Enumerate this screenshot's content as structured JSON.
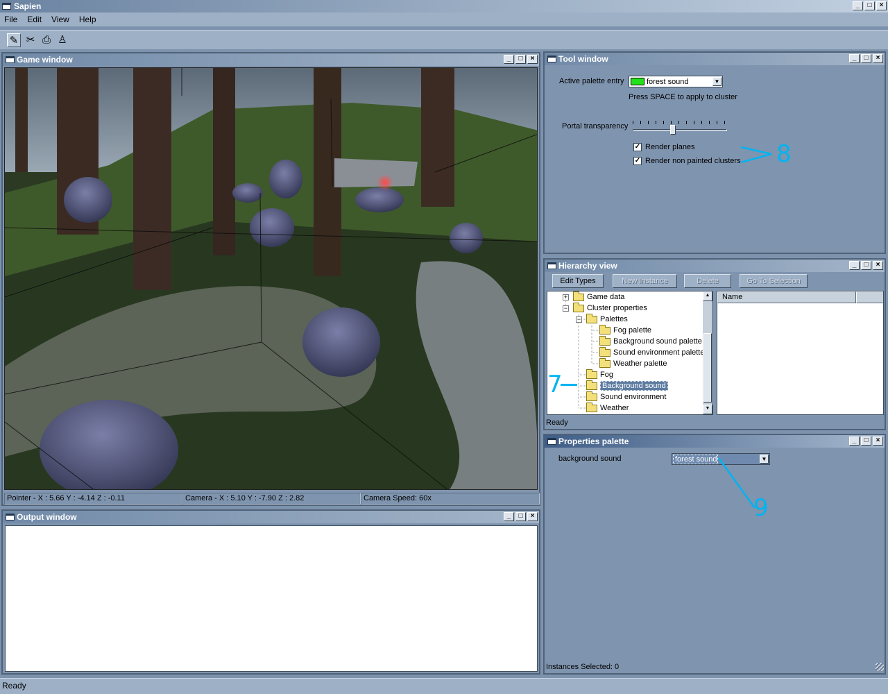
{
  "app": {
    "title": "Sapien",
    "window_buttons": [
      "_",
      "□",
      "×"
    ]
  },
  "menu": {
    "items": [
      "File",
      "Edit",
      "View",
      "Help"
    ]
  },
  "toolbar": {
    "tools": [
      "pencil-tool-icon",
      "pointer-tool-icon",
      "camera-tool-icon",
      "character-tool-icon"
    ]
  },
  "game_window": {
    "title": "Game window",
    "status": {
      "pointer": "Pointer - X : 5.66  Y : -4.14  Z : -0.11",
      "camera": "Camera - X : 5.10  Y : -7.90  Z : 2.82",
      "speed": "Camera Speed: 60x"
    }
  },
  "output_window": {
    "title": "Output window"
  },
  "tool_window": {
    "title": "Tool window",
    "active_palette_label": "Active palette entry",
    "active_palette_value": "forest sound",
    "swatch_color": "#23e01a",
    "hint": "Press SPACE to apply to cluster",
    "portal_label": "Portal transparency",
    "portal_level": 0.42,
    "render_planes": "Render planes",
    "render_non_painted": "Render non painted clusters",
    "render_planes_checked": true,
    "render_non_painted_checked": true
  },
  "hierarchy": {
    "title": "Hierarchy view",
    "buttons": [
      "Edit Types",
      "New Instance",
      "Delete",
      "Go To Selection"
    ],
    "tree": [
      "Game data",
      "Cluster properties",
      "Palettes",
      "Fog palette",
      "Background sound palette",
      "Sound environment palette",
      "Weather palette",
      "Fog",
      "Background sound",
      "Sound environment",
      "Weather"
    ],
    "selected": "Background sound",
    "list_header": "Name",
    "status": "Ready"
  },
  "properties": {
    "title": "Properties palette",
    "label": "background sound",
    "value": "forest sound",
    "status": "Instances Selected: 0"
  },
  "annotations": {
    "a8": "8",
    "a7": "7",
    "a9": "9"
  },
  "status_bar": "Ready"
}
